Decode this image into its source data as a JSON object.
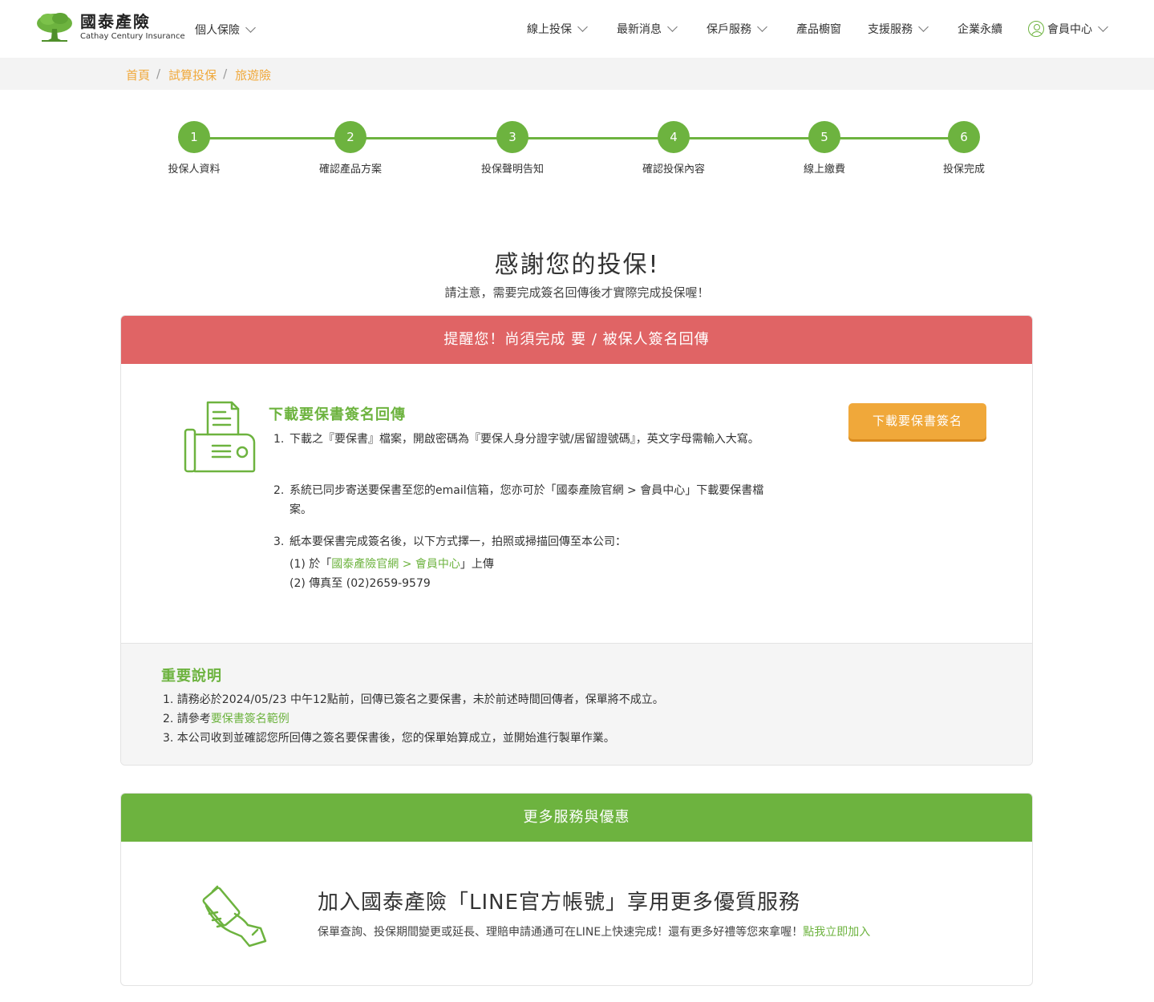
{
  "header": {
    "logo_cn": "國泰產險",
    "logo_en": "Cathay Century Insurance",
    "personal_menu": "個人保險",
    "nav": [
      {
        "id": "online-apply",
        "label": "線上投保",
        "has_dropdown": true
      },
      {
        "id": "news",
        "label": "最新消息",
        "has_dropdown": true
      },
      {
        "id": "customer-service",
        "label": "保戶服務",
        "has_dropdown": true
      },
      {
        "id": "products",
        "label": "產品櫥窗",
        "has_dropdown": false
      },
      {
        "id": "support",
        "label": "支援服務",
        "has_dropdown": true
      },
      {
        "id": "sustainability",
        "label": "企業永續",
        "has_dropdown": false
      },
      {
        "id": "member",
        "label": "會員中心",
        "has_dropdown": true
      }
    ]
  },
  "breadcrumb": [
    "首頁",
    "試算投保",
    "旅遊險"
  ],
  "steps": [
    {
      "num": "1",
      "label": "投保人資料"
    },
    {
      "num": "2",
      "label": "確認產品方案"
    },
    {
      "num": "3",
      "label": "投保聲明告知"
    },
    {
      "num": "4",
      "label": "確認投保內容"
    },
    {
      "num": "5",
      "label": "線上繳費"
    },
    {
      "num": "6",
      "label": "投保完成"
    }
  ],
  "thanks": {
    "title": "感謝您的投保!",
    "subtitle": "請注意，需要完成簽名回傳後才實際完成投保喔！"
  },
  "reminder": {
    "header": "提醒您！尚須完成 要 / 被保人簽名回傳",
    "download_title": "下載要保書簽名回傳",
    "item1_num": "1.",
    "item1_text": "下載之『要保書』檔案，開啟密碼為『要保人身分證字號/居留證號碼』，英文字母需輸入大寫。",
    "item2_num": "2.",
    "item2_text": "系統已同步寄送要保書至您的email信箱，您亦可於「國泰產險官網 > 會員中心」下載要保書檔案。",
    "item3_num": "3.",
    "item3_text": "紙本要保書完成簽名後，以下方式擇一，拍照或掃描回傳至本公司：",
    "sub1_prefix": "(1) 於「",
    "sub1_link": "國泰產險官網 > 會員中心",
    "sub1_suffix": "」上傳",
    "sub2": "(2) 傳真至 (02)2659-9579",
    "download_button": "下載要保書簽名"
  },
  "important": {
    "title": "重要說明",
    "item1": "1. 請務必於2024/05/23 中午12點前，回傳已簽名之要保書，未於前述時間回傳者，保單將不成立。",
    "item2_prefix": "2. 請參考",
    "item2_link": "要保書簽名範例",
    "item3": "3. 本公司收到並確認您所回傳之簽名要保書後，您的保單始算成立，並開始進行製單作業。"
  },
  "services": {
    "header": "更多服務與優惠",
    "title": "加入國泰產險「LINE官方帳號」享用更多優質服務",
    "desc": "保單查詢、投保期間變更或延長、理賠申請通通可在LINE上快速完成！還有更多好禮等您來拿喔！",
    "link": "點我立即加入"
  },
  "colors": {
    "brand_green": "#6db33f",
    "reminder_red": "#e06465",
    "accent_orange": "#f0a83a"
  }
}
